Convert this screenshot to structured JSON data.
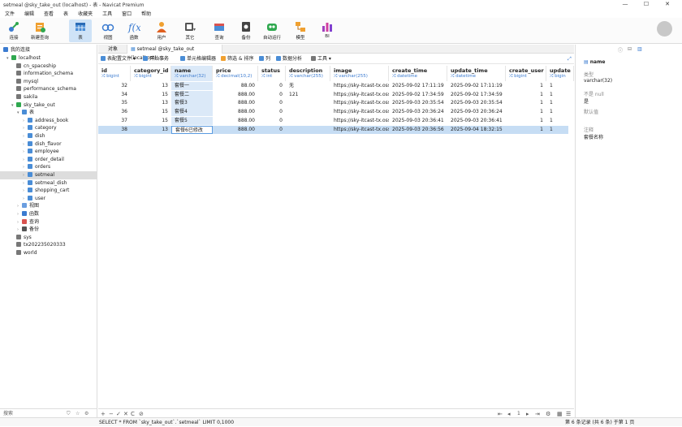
{
  "title": "setmeal @sky_take_out (localhost) - 表 - Navicat Premium",
  "window_controls": {
    "minimize": "—",
    "maximize": "☐",
    "close": "✕"
  },
  "menu": [
    "文件",
    "编辑",
    "查看",
    "表",
    "收藏夹",
    "工具",
    "窗口",
    "帮助"
  ],
  "toolbar": [
    {
      "label": "连接",
      "icon": "connection-icon"
    },
    {
      "label": "新建查询",
      "icon": "new-query-icon"
    },
    {
      "label": "表",
      "icon": "table-icon",
      "selected": true
    },
    {
      "label": "视图",
      "icon": "view-icon"
    },
    {
      "label": "函数",
      "icon": "function-icon"
    },
    {
      "label": "用户",
      "icon": "user-icon"
    },
    {
      "label": "其它",
      "icon": "other-icon"
    },
    {
      "label": "查询",
      "icon": "query-icon"
    },
    {
      "label": "备份",
      "icon": "backup-icon"
    },
    {
      "label": "自动运行",
      "icon": "automation-icon"
    },
    {
      "label": "模型",
      "icon": "model-icon"
    },
    {
      "label": "BI",
      "icon": "bi-icon"
    }
  ],
  "sidebar": {
    "header": "我的连接",
    "tree": [
      {
        "label": "localhost",
        "level": 1,
        "arrow": "v",
        "color": "#2fa84f"
      },
      {
        "label": "cn_spaceship",
        "level": 2,
        "arrow": "",
        "color": "#777"
      },
      {
        "label": "information_schema",
        "level": 2,
        "arrow": "",
        "color": "#777"
      },
      {
        "label": "mysql",
        "level": 2,
        "arrow": "",
        "color": "#777"
      },
      {
        "label": "performance_schema",
        "level": 2,
        "arrow": "",
        "color": "#777"
      },
      {
        "label": "sakila",
        "level": 2,
        "arrow": "",
        "color": "#777"
      },
      {
        "label": "sky_take_out",
        "level": 2,
        "arrow": "v",
        "color": "#2fa84f"
      },
      {
        "label": "表",
        "level": 3,
        "arrow": "v",
        "color": "#4a8dd6"
      },
      {
        "label": "address_book",
        "level": 4,
        "arrow": ">",
        "color": "#4a8dd6"
      },
      {
        "label": "category",
        "level": 4,
        "arrow": ">",
        "color": "#4a8dd6"
      },
      {
        "label": "dish",
        "level": 4,
        "arrow": ">",
        "color": "#4a8dd6"
      },
      {
        "label": "dish_flavor",
        "level": 4,
        "arrow": ">",
        "color": "#4a8dd6"
      },
      {
        "label": "employee",
        "level": 4,
        "arrow": ">",
        "color": "#4a8dd6"
      },
      {
        "label": "order_detail",
        "level": 4,
        "arrow": ">",
        "color": "#4a8dd6"
      },
      {
        "label": "orders",
        "level": 4,
        "arrow": ">",
        "color": "#4a8dd6"
      },
      {
        "label": "setmeal",
        "level": 4,
        "arrow": ">",
        "color": "#4a8dd6",
        "selected": true
      },
      {
        "label": "setmeal_dish",
        "level": 4,
        "arrow": ">",
        "color": "#4a8dd6"
      },
      {
        "label": "shopping_cart",
        "level": 4,
        "arrow": ">",
        "color": "#4a8dd6"
      },
      {
        "label": "user",
        "level": 4,
        "arrow": ">",
        "color": "#4a8dd6"
      },
      {
        "label": "视图",
        "level": 3,
        "arrow": ">",
        "color": "#6a9ee0"
      },
      {
        "label": "函数",
        "level": 3,
        "arrow": ">",
        "color": "#3b7bd0"
      },
      {
        "label": "查询",
        "level": 3,
        "arrow": ">",
        "color": "#d9534f"
      },
      {
        "label": "备份",
        "level": 3,
        "arrow": ">",
        "color": "#555"
      },
      {
        "label": "sys",
        "level": 2,
        "arrow": "",
        "color": "#777"
      },
      {
        "label": "tx202235020333",
        "level": 2,
        "arrow": "",
        "color": "#777"
      },
      {
        "label": "world",
        "level": 2,
        "arrow": "",
        "color": "#777"
      }
    ],
    "search_placeholder": "搜索"
  },
  "tabs": [
    {
      "label": "对象",
      "active": false
    },
    {
      "label": "setmeal @sky_take_out (localhost) - ...",
      "active": true
    }
  ],
  "table_toolbar": [
    "表配置文件 ▾",
    "开始事务",
    "单元格编辑器",
    "筛选 & 排序",
    "列",
    "数据分析",
    "工具 ▾"
  ],
  "columns": [
    {
      "name": "id",
      "type": "bigint"
    },
    {
      "name": "category_id",
      "type": "bigint"
    },
    {
      "name": "name",
      "type": "varchar(32)",
      "selected": true
    },
    {
      "name": "price",
      "type": "decimal(10,2)"
    },
    {
      "name": "status",
      "type": "int"
    },
    {
      "name": "description",
      "type": "varchar(255)"
    },
    {
      "name": "image",
      "type": "varchar(255)"
    },
    {
      "name": "create_time",
      "type": "datetime"
    },
    {
      "name": "update_time",
      "type": "datetime"
    },
    {
      "name": "create_user",
      "type": "bigint"
    },
    {
      "name": "update",
      "type": "bigin"
    }
  ],
  "rows": [
    [
      "32",
      "13",
      "套餐一",
      "88.00",
      "0",
      "无",
      "https://sky-itcast-tx.oss",
      "2025-09-02 17:11:19",
      "2025-09-02 17:11:19",
      "1",
      "1"
    ],
    [
      "34",
      "15",
      "套餐二",
      "888.00",
      "0",
      "121",
      "https://sky-itcast-tx.oss",
      "2025-09-02 17:34:59",
      "2025-09-02 17:34:59",
      "1",
      "1"
    ],
    [
      "35",
      "13",
      "套餐3",
      "888.00",
      "0",
      "",
      "https://sky-itcast-tx.oss",
      "2025-09-03 20:35:54",
      "2025-09-03 20:35:54",
      "1",
      "1"
    ],
    [
      "36",
      "15",
      "套餐4",
      "888.00",
      "0",
      "",
      "https://sky-itcast-tx.oss",
      "2025-09-03 20:36:24",
      "2025-09-03 20:36:24",
      "1",
      "1"
    ],
    [
      "37",
      "15",
      "套餐5",
      "888.00",
      "0",
      "",
      "https://sky-itcast-tx.oss",
      "2025-09-03 20:36:41",
      "2025-09-03 20:36:41",
      "1",
      "1"
    ],
    [
      "38",
      "13",
      "套餐6已修改",
      "888.00",
      "0",
      "",
      "https://sky-itcast-tx.oss",
      "2025-09-03 20:36:56",
      "2025-09-04 18:32:15",
      "1",
      "1"
    ]
  ],
  "selected_row": 5,
  "properties": {
    "field_name": "name",
    "type_label": "类型",
    "type_value": "varchar(32)",
    "notnull_label": "不是 null",
    "notnull_value": "是",
    "default_label": "默认值",
    "default_value": "",
    "comment_label": "注释",
    "comment_value": "套餐名称"
  },
  "grid_footer": {
    "add": "+",
    "delete": "−",
    "apply": "✓",
    "discard": "✕",
    "refresh": "C",
    "stop": "⊘",
    "page": "1"
  },
  "status": {
    "sql": "SELECT * FROM `sky_take_out`.`setmeal` LIMIT 0,1000",
    "records": "第 6 条记录 (共 6 条) 于第 1 页"
  }
}
